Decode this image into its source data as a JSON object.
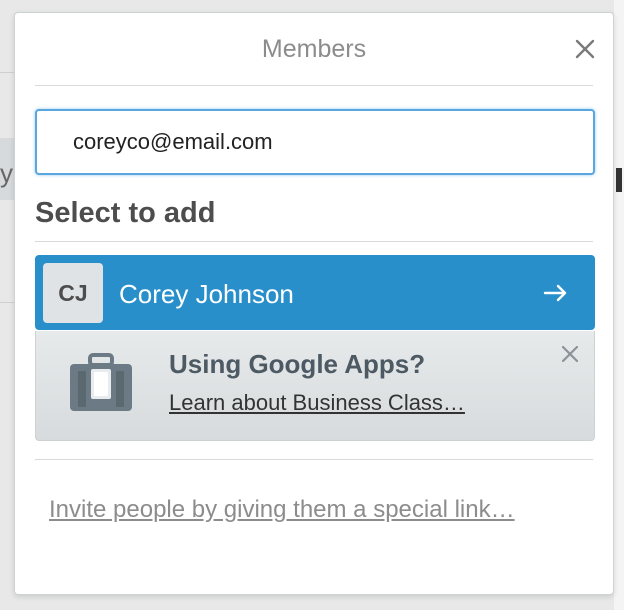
{
  "popover": {
    "title": "Members"
  },
  "search": {
    "value": "coreyco@email.com"
  },
  "select_section": {
    "heading": "Select to add"
  },
  "member_result": {
    "initials": "CJ",
    "name": "Corey Johnson",
    "arrow_glyph": "→"
  },
  "promo": {
    "title": "Using Google Apps?",
    "link": "Learn about Business Class…"
  },
  "invite": {
    "link": "Invite people by giving them a special link…"
  },
  "background": {
    "left_fragment": "y"
  },
  "colors": {
    "accent": "#298fca",
    "input_focus_border": "#5aa7e0",
    "promo_background": "#dfe3e6"
  },
  "icons": {
    "close": "close-icon",
    "arrow": "arrow-right-icon",
    "promo": "briefcase-icon",
    "promo_close": "close-icon"
  }
}
